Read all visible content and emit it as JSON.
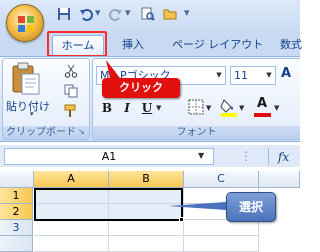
{
  "quick_access": {
    "icons": [
      "save-icon",
      "undo-icon",
      "redo-icon",
      "print-preview-icon",
      "open-folder-icon"
    ]
  },
  "ribbon_tabs": [
    {
      "label": "ホーム",
      "active": true
    },
    {
      "label": "挿入",
      "active": false
    },
    {
      "label": "ページ レイアウト",
      "active": false
    },
    {
      "label": "数式",
      "active": false
    }
  ],
  "clipboard_group": {
    "paste_label": "貼り付け",
    "title": "クリップボード"
  },
  "font_group": {
    "font_name": "MS Pゴシック",
    "font_size": "11",
    "bold": "B",
    "italic": "I",
    "underline": "U",
    "font_color_glyph": "A",
    "title": "フォント"
  },
  "callouts": {
    "click": "クリック",
    "select": "選択"
  },
  "formula_bar": {
    "name_box": "A1",
    "fx": "fx"
  },
  "grid": {
    "columns": [
      "A",
      "B",
      "C"
    ],
    "rows": [
      "1",
      "2",
      "3"
    ]
  },
  "colors": {
    "highlight_red": "#ff2a2a",
    "callout_red": "#e20f0f",
    "callout_blue": "#4b73bb",
    "ribbon_blue": "#c8daf2"
  }
}
